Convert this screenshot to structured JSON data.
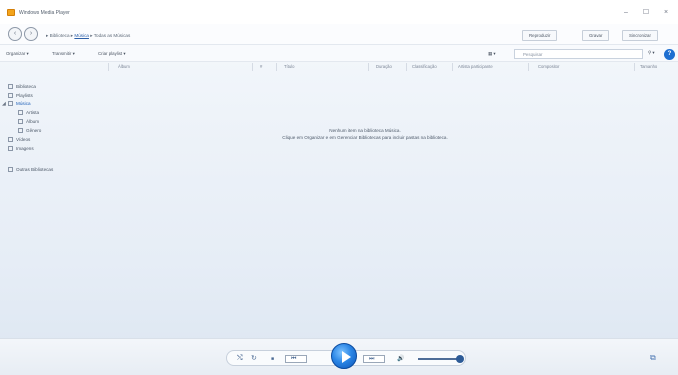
{
  "window": {
    "title": "Windows Media Player",
    "controls": {
      "minimize": "–",
      "maximize": "☐",
      "close": "×"
    }
  },
  "nav": {
    "back_symbol": "‹",
    "forward_symbol": "›",
    "breadcrumb": {
      "root": "Biblioteca",
      "current": "Música",
      "tail": "Todas as Músicas"
    },
    "tabs": [
      "Reproduzir",
      "Gravar",
      "Sincronizar"
    ]
  },
  "toolbar": {
    "organize": "Organizar",
    "stream": "Transmitir",
    "create_playlist": "Criar playlist",
    "search_placeholder": "Pesquisar",
    "help": "?"
  },
  "columns": [
    "Álbum",
    "#",
    "Título",
    "Duração",
    "Classificação",
    "Artista participante",
    "Compositor",
    "Tamanho"
  ],
  "navpane": {
    "items": [
      {
        "label": "Biblioteca",
        "icon": "library-icon"
      },
      {
        "label": "Playlists",
        "icon": "playlist-icon"
      },
      {
        "label": "Música",
        "icon": "music-icon"
      },
      {
        "label": "Artista",
        "icon": "artist-icon"
      },
      {
        "label": "Álbum",
        "icon": "album-icon"
      },
      {
        "label": "Gênero",
        "icon": "genre-icon"
      },
      {
        "label": "Vídeos",
        "icon": "video-icon"
      },
      {
        "label": "Imagens",
        "icon": "picture-icon"
      },
      {
        "label": "Outras Bibliotecas",
        "icon": "other-libraries-icon"
      }
    ]
  },
  "empty_message": {
    "line1": "Nenhum item na biblioteca Música.",
    "line2": "Clique em Organizar e em Gerenciar Bibliotecas para incluir pastas na biblioteca."
  },
  "player": {
    "shuffle": "⤭",
    "repeat": "↻",
    "stop": "■",
    "prev": "⏮",
    "next": "⏭",
    "mute": "🔊",
    "switch_view": "⧉"
  },
  "colors": {
    "accent": "#1f6fd0",
    "play_button": "#2b86e6"
  }
}
